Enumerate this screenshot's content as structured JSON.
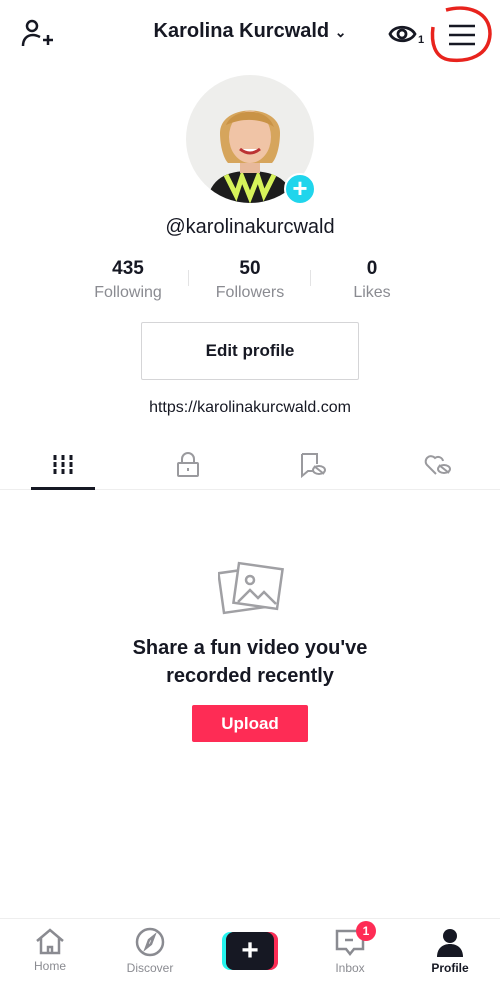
{
  "header": {
    "title": "Karolina Kurcwald",
    "views_count": "1"
  },
  "profile": {
    "username": "@karolinakurcwald",
    "link": "https://karolinakurcwald.com",
    "edit_label": "Edit profile"
  },
  "stats": [
    {
      "value": "435",
      "label": "Following"
    },
    {
      "value": "50",
      "label": "Followers"
    },
    {
      "value": "0",
      "label": "Likes"
    }
  ],
  "tabs": [
    "videos-grid-icon",
    "lock-icon",
    "bookmark-hidden-icon",
    "heart-hidden-icon"
  ],
  "empty": {
    "line1": "Share a fun video you've",
    "line2": "recorded recently",
    "upload_label": "Upload"
  },
  "nav": {
    "home": "Home",
    "discover": "Discover",
    "inbox": "Inbox",
    "inbox_badge": "1",
    "profile": "Profile"
  },
  "colors": {
    "accent": "#fe2c55",
    "cyan": "#25f4ee",
    "annotation": "#e8231d"
  }
}
